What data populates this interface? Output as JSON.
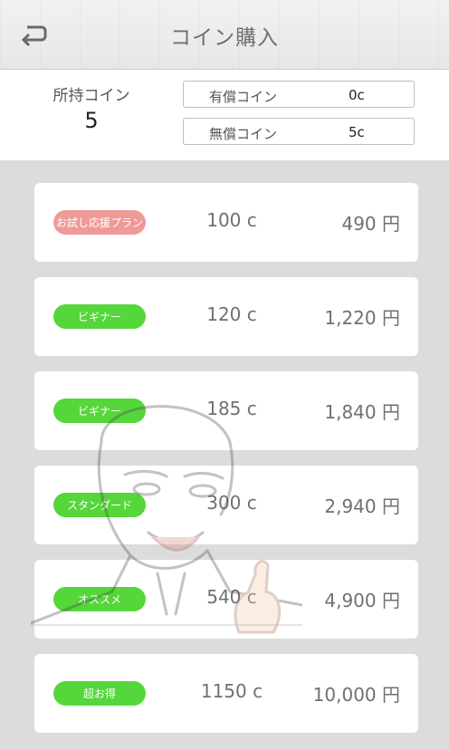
{
  "header": {
    "title": "コイン購入",
    "back_icon": "back-arrow-icon"
  },
  "summary": {
    "owned_label": "所持コイン",
    "owned_value": "5",
    "paid_label": "有償コイン",
    "paid_value": "0c",
    "free_label": "無償コイン",
    "free_value": "5c"
  },
  "plans": [
    {
      "badge": "お試し応援プラン",
      "coins": "100 c",
      "price": "490 円"
    },
    {
      "badge": "ビギナー",
      "coins": "120 c",
      "price": "1,220 円"
    },
    {
      "badge": "ビギナー",
      "coins": "185 c",
      "price": "1,840 円"
    },
    {
      "badge": "スタンダード",
      "coins": "300 c",
      "price": "2,940 円"
    },
    {
      "badge": "オススメ",
      "coins": "540 c",
      "price": "4,900 円"
    },
    {
      "badge": "超お得",
      "coins": "1150 c",
      "price": "10,000 円"
    }
  ],
  "colors": {
    "badge_trial": "#ee9a97",
    "badge_default": "#55d63a",
    "text": "#707070"
  }
}
